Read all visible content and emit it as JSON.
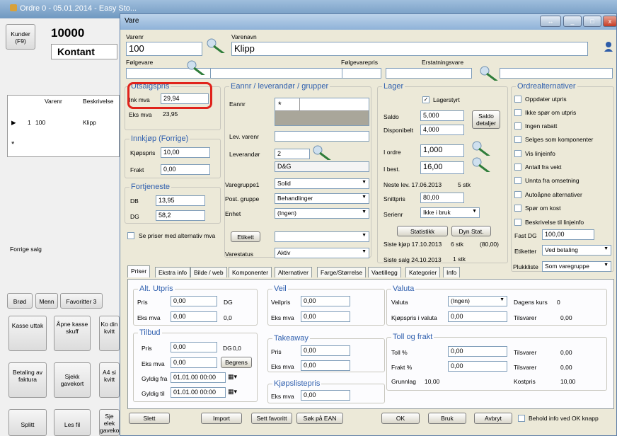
{
  "bg": {
    "title": "Ordre 0 - 05.01.2014 - Easy Sto...",
    "kunder_label": "Kunder (F9)",
    "customer_no": "10000",
    "customer_name": "Kontant",
    "grid_headers": [
      "Varenr",
      "Beskrivelse"
    ],
    "row_index": "1",
    "row_varenr": "100",
    "row_desc": "Klipp",
    "star": "*",
    "forrige_salg": "Forrige salg",
    "tabs": [
      "Brød",
      "Menn",
      "Favoritter 3"
    ],
    "buttons": [
      "Kasse uttak",
      "Åpne kasse skuff",
      "Ko din kvitt",
      "Betaling av faktura",
      "Sjekk gavekort",
      "A4 si kvitt",
      "Splitt",
      "Les fil",
      "Sje elek gavekort"
    ]
  },
  "win": {
    "title": "Vare",
    "varenr_label": "Varenr",
    "varenr": "100",
    "varenavn_label": "Varenavn",
    "varenavn": "Klipp",
    "folgevare_label": "Følgevare",
    "folgevarepris_label": "Følgevarepris",
    "erstatningsvare_label": "Erstatningsvare",
    "utsalgspris": {
      "title": "Utsalgspris",
      "ink_label": "Ink mva",
      "ink": "29,94",
      "eks_label": "Eks mva",
      "eks": "23,95"
    },
    "innkjop": {
      "title": "Innkjøp (Forrige)",
      "kjopspris_label": "Kjøpspris",
      "kjopspris": "10,00",
      "frakt_label": "Frakt",
      "frakt": "0,00"
    },
    "fortjeneste": {
      "title": "Fortjeneste",
      "db_label": "DB",
      "db": "13,95",
      "dg_label": "DG",
      "dg": "58,2"
    },
    "se_priser": "Se priser med alternativ mva",
    "eannr": {
      "title": "Eannr / leverandør / grupper",
      "eannr_label": "Eannr",
      "star": "*",
      "lev_varenr_label": "Lev. varenr",
      "leverandor_label": "Leverandør",
      "leverandor": "2",
      "leverandor_name": "D&G",
      "varegruppe_label": "Varegruppe1",
      "varegruppe": "Solid",
      "post_gruppe_label": "Post. gruppe",
      "post_gruppe": "Behandlinger",
      "enhet_label": "Enhet",
      "enhet": "(Ingen)",
      "etikett_btn": "Etikett",
      "varestatus_label": "Varestatus",
      "varestatus": "Aktiv"
    },
    "lager": {
      "title": "Lager",
      "lagerstyrt": "Lagerstyrt",
      "saldo_label": "Saldo",
      "saldo": "5,000",
      "saldo_btn": "Saldo detaljer",
      "disponibelt_label": "Disponibelt",
      "disponibelt": "4,000",
      "i_ordre_label": "I ordre",
      "i_ordre": "1,000",
      "i_best_label": "I best.",
      "i_best": "16,00",
      "neste_lev": "Neste lev. 17.06.2013",
      "neste_stk": "5 stk",
      "snittpris_label": "Snittpris",
      "snittpris": "80,00",
      "serienr_label": "Serienr",
      "serienr": "Ikke i bruk",
      "statistikk_btn": "Statistikk",
      "dynstat_btn": "Dyn Stat.",
      "siste_kjop": "Siste kjøp 17.10.2013",
      "siste_kjop_stk": "6 stk",
      "siste_kjop_pris": "(80,00)",
      "siste_salg": "Siste salg 24.10.2013",
      "siste_salg_stk": "1 stk"
    },
    "ordre": {
      "title": "Ordrealternativer",
      "options": [
        "Oppdater utpris",
        "Ikke spør om utpris",
        "Ingen rabatt",
        "Selges som komponenter",
        "Vis linjeinfo",
        "Antall fra vekt",
        "Unnta fra omsetning",
        "Autoåpne alternativer",
        "Spør om kost",
        "Beskrivelse til linjeinfo"
      ],
      "fast_dg_label": "Fast DG",
      "fast_dg": "100,00",
      "etiketter_label": "Etiketter",
      "etiketter": "Ved betaling",
      "plukkliste_label": "Plukkliste",
      "plukkliste": "Som varegruppe"
    },
    "tabs": [
      "Priser",
      "Ekstra info",
      "Bilde / web",
      "Komponenter",
      "Alternativer",
      "Farge/Størrelse",
      "Vaetillegg",
      "Kategorier",
      "Info"
    ],
    "alt": {
      "title": "Alt. Utpris",
      "pris_label": "Pris",
      "pris": "0,00",
      "dg_label": "DG",
      "eks_label": "Eks mva",
      "eks": "0,00",
      "dg": "0,0"
    },
    "veil": {
      "title": "Veil",
      "veilpris_label": "Veilpris",
      "veilpris": "0,00",
      "eks_label": "Eks mva",
      "eks": "0,00"
    },
    "valuta": {
      "title": "Valuta",
      "valuta_label": "Valuta",
      "valuta": "(Ingen)",
      "dagens_label": "Dagens kurs",
      "dagens": "0",
      "kjopspris_label": "Kjøpspris i valuta",
      "kjopspris": "0,00",
      "tilsvarer_label": "Tilsvarer",
      "tilsvarer": "0,00"
    },
    "tilbud": {
      "title": "Tilbud",
      "pris_label": "Pris",
      "pris": "0,00",
      "dg_label": "DG",
      "dg": "0,0",
      "eks_label": "Eks mva",
      "eks": "0,00",
      "begrens_btn": "Begrens",
      "fra_label": "Gyldig fra",
      "fra": "01.01.00 00:00",
      "til_label": "Gyldig til",
      "til": "01.01.00 00:00"
    },
    "takeaway": {
      "title": "Takeaway",
      "pris_label": "Pris",
      "pris": "0,00",
      "eks_label": "Eks mva",
      "eks": "0,00"
    },
    "toll": {
      "title": "Toll og frakt",
      "toll_label": "Toll %",
      "toll": "0,00",
      "toll_tils_label": "Tilsvarer",
      "toll_tils": "0,00",
      "frakt_label": "Frakt %",
      "frakt": "0,00",
      "frakt_tils_label": "Tilsvarer",
      "frakt_tils": "0,00",
      "grunnlag_label": "Grunnlag",
      "grunnlag": "10,00",
      "kostpris_label": "Kostpris",
      "kostpris": "10,00"
    },
    "kjopsliste": {
      "title": "Kjøpslistepris",
      "eks_label": "Eks mva",
      "eks": "0,00"
    },
    "footer": {
      "slett": "Slett",
      "import": "Import",
      "sett_favoritt": "Sett favoritt",
      "sok_ean": "Søk på EAN",
      "ok": "OK",
      "bruk": "Bruk",
      "avbryt": "Avbryt",
      "behold": "Behold info ved OK knapp"
    }
  },
  "colors": {
    "highlight": "#e0231b",
    "group_title": "#2f5fae"
  }
}
